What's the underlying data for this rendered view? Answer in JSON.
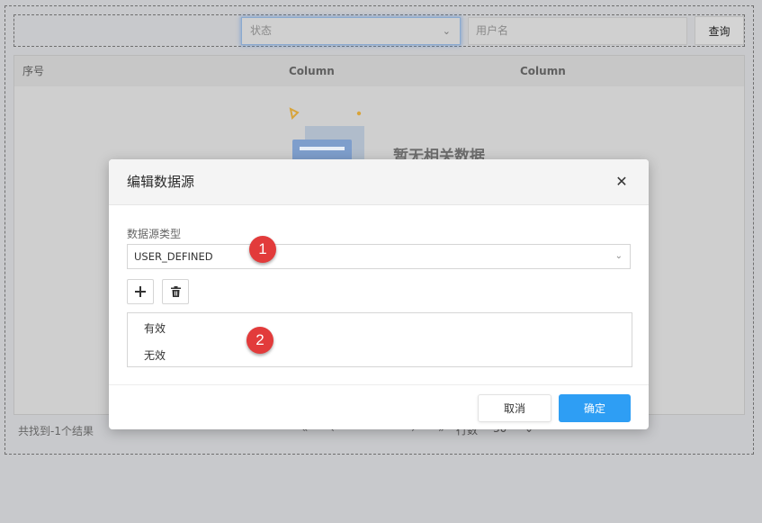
{
  "search": {
    "status_placeholder": "状态",
    "username_placeholder": "用户名",
    "query_label": "查询"
  },
  "table": {
    "headers": [
      "序号",
      "Column",
      "Column"
    ],
    "empty_text": "暂无相关数据"
  },
  "footer": {
    "result_count": "共找到-1个结果",
    "page_size_label": "行数",
    "page_size": "30"
  },
  "modal": {
    "title": "编辑数据源",
    "close_glyph": "✕",
    "field_label": "数据源类型",
    "type_value": "USER_DEFINED",
    "options": [
      "有效",
      "无效"
    ],
    "cancel_label": "取消",
    "ok_label": "确定"
  },
  "markers": [
    "1",
    "2"
  ],
  "colors": {
    "primary": "#2e9ef4",
    "marker": "#e23b3b",
    "overlay": "#c8c9cc"
  },
  "icons": {
    "add": "plus-icon",
    "delete": "trash-icon",
    "close": "close-icon"
  }
}
